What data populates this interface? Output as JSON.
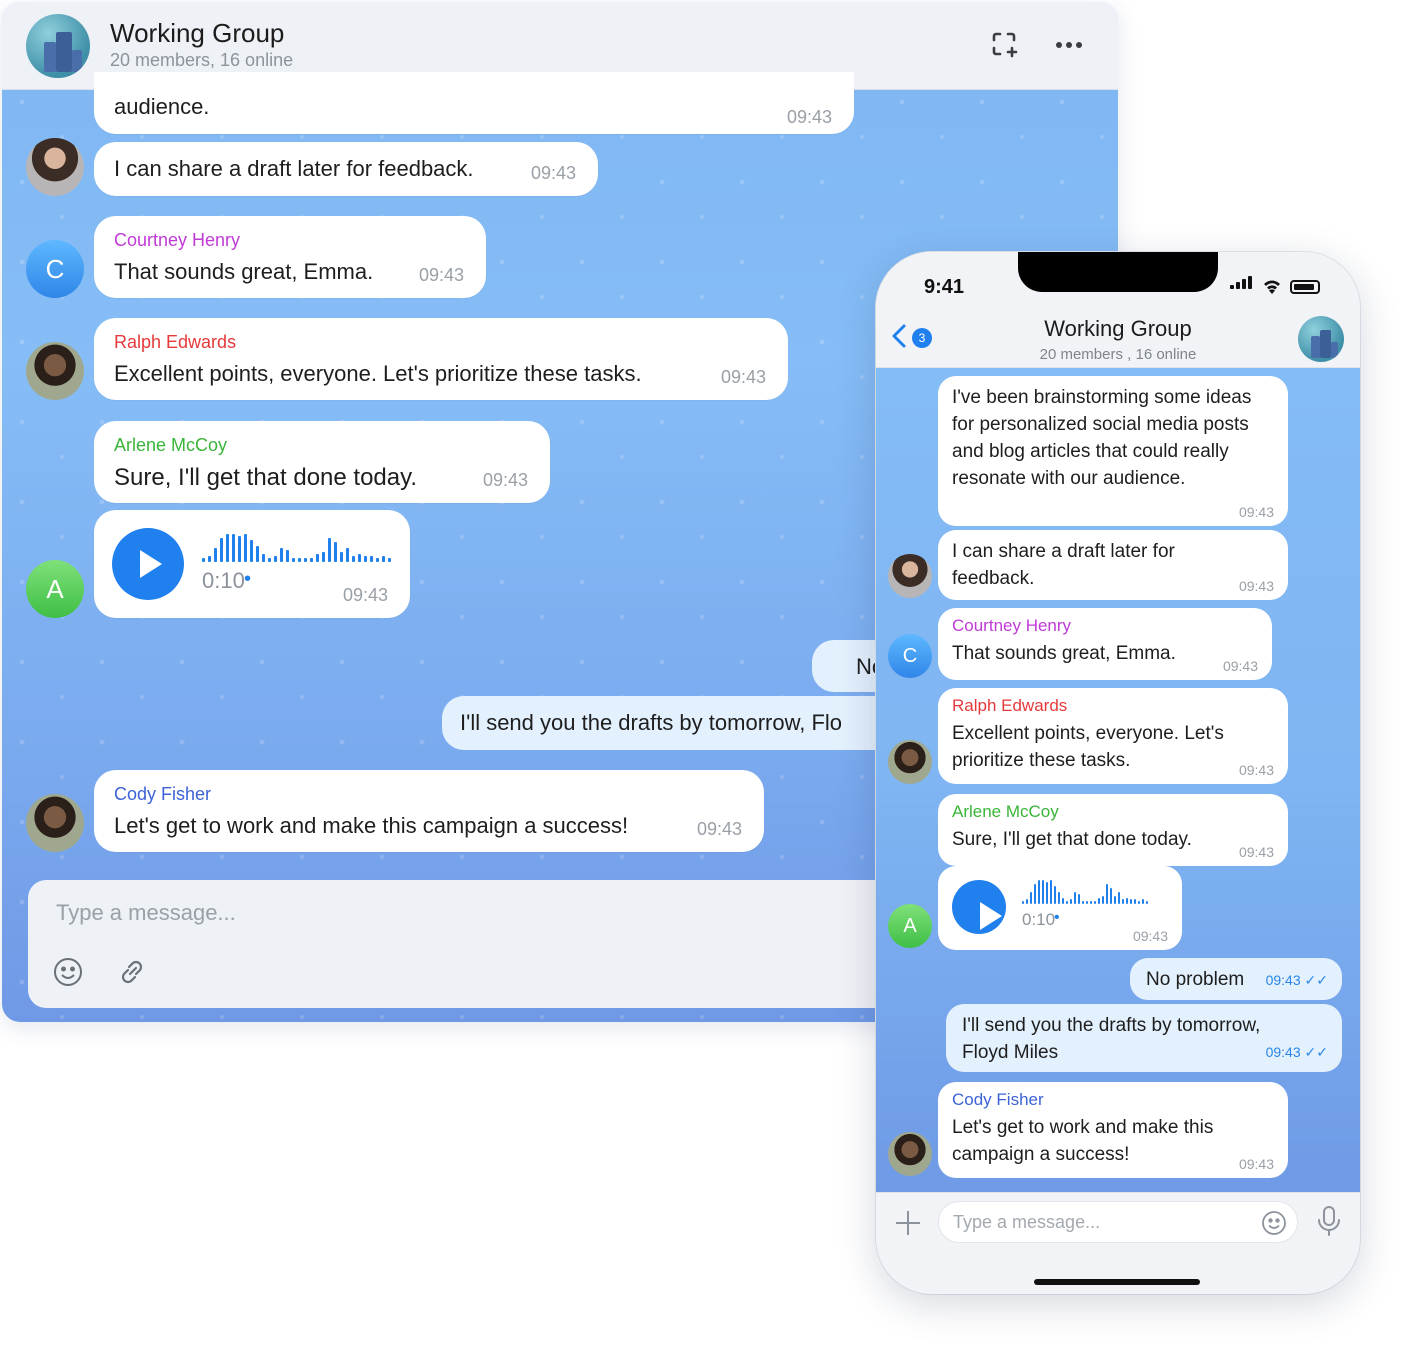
{
  "desktop": {
    "title": "Working Group",
    "subtitle": "20 members, 16 online",
    "messages": {
      "m0_text": "audience.",
      "m0_time": "09:43",
      "m1_text": "I can share a draft later for feedback.",
      "m1_time": "09:43",
      "m2_sender": "Courtney Henry",
      "m2_text": "That sounds great, Emma.",
      "m2_time": "09:43",
      "m2_avatar": "C",
      "m3_sender": "Ralph Edwards",
      "m3_text": "Excellent points, everyone. Let's prioritize these tasks.",
      "m3_time": "09:43",
      "m4_sender": "Arlene McCoy",
      "m4_text": "Sure, I'll get that done today.",
      "m4_time": "09:43",
      "voice_duration": "0:10",
      "voice_dot": "•",
      "voice_time": "09:43",
      "voice_avatar": "A",
      "out1_text": "No",
      "out2_text": "I'll send you the drafts by tomorrow, Flo",
      "m7_sender": "Cody Fisher",
      "m7_text": "Let's get to work and make this campaign a success!",
      "m7_time": "09:43"
    },
    "input_placeholder": "Type a message...",
    "colors": {
      "courtney": "#c03ad6",
      "ralph": "#e5393b",
      "arlene": "#3ab53a",
      "cody": "#3d63d6",
      "accent": "#1f80ee"
    }
  },
  "phone": {
    "clock": "9:41",
    "back_badge": "3",
    "title": "Working Group",
    "subtitle": "20 members , 16 online",
    "messages": {
      "p0_text": "I've been brainstorming some ideas for personalized social media posts and blog articles that could really resonate with our audience.",
      "p0_time": "09:43",
      "p1_text": "I can share a draft later for feedback.",
      "p1_time": "09:43",
      "p2_sender": "Courtney Henry",
      "p2_text": "That sounds great, Emma.",
      "p2_time": "09:43",
      "p2_avatar": "C",
      "p3_sender": "Ralph Edwards",
      "p3_text": "Excellent points, everyone. Let's prioritize these tasks.",
      "p3_time": "09:43",
      "p4_sender": "Arlene McCoy",
      "p4_text": "Sure, I'll get that done today.",
      "p4_time": "09:43",
      "voice_duration": "0:10",
      "voice_dot": "•",
      "voice_time": "09:43",
      "voice_avatar": "A",
      "out1_text": "No problem",
      "out1_time": "09:43",
      "out2_text": "I'll send you the drafts by tomorrow, Floyd Miles",
      "out2_time": "09:43",
      "p7_sender": "Cody Fisher",
      "p7_text": "Let's get to work and make this campaign a success!",
      "p7_time": "09:43"
    },
    "input_placeholder": "Type a message..."
  }
}
